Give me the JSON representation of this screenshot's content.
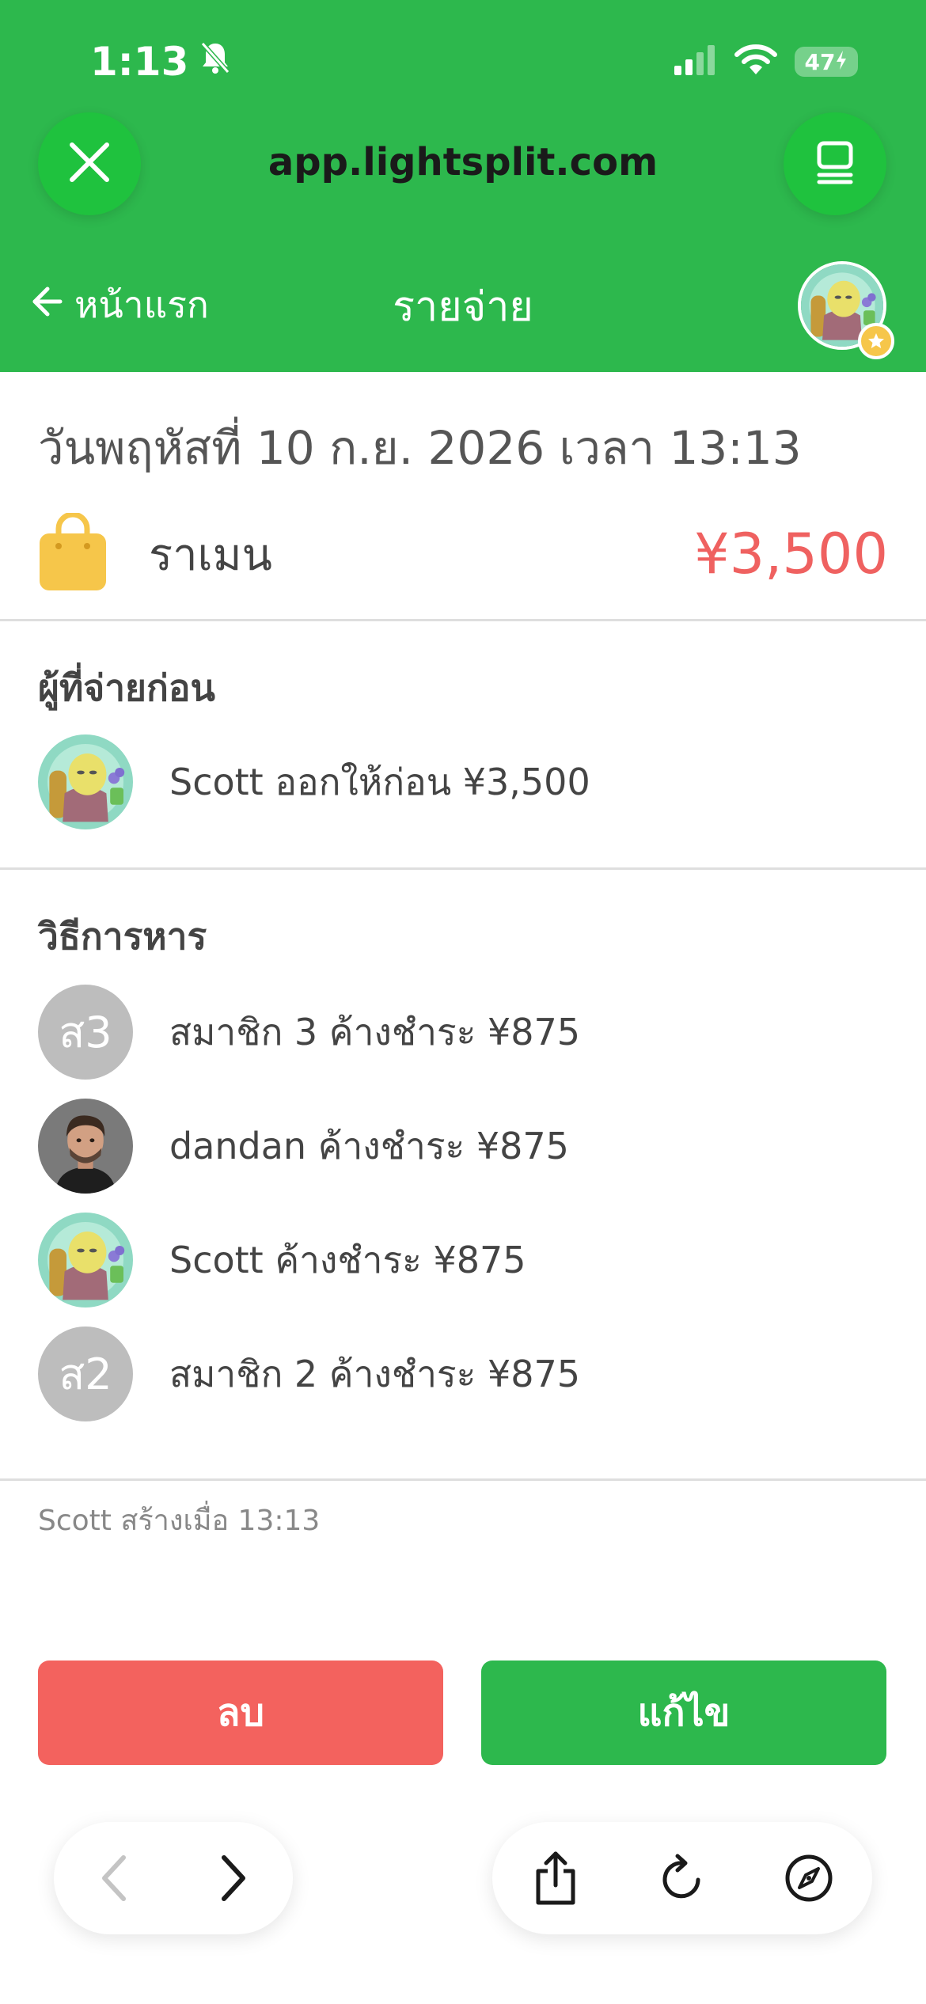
{
  "status_bar": {
    "time": "1:13",
    "battery": "47"
  },
  "browser": {
    "url": "app.lightsplit.com"
  },
  "nav": {
    "back_label": "หน้าแรก",
    "title": "รายจ่าย"
  },
  "expense": {
    "date": "วันพฤหัสที่ 10 ก.ย. 2026 เวลา 13:13",
    "name": "ราเมน",
    "amount": "¥3,500",
    "category_icon": "shopping-bag-icon"
  },
  "payers": {
    "title": "ผู้ที่จ่ายก่อน",
    "items": [
      {
        "avatar": "character-avatar",
        "text": "Scott ออกให้ก่อน ¥3,500"
      }
    ]
  },
  "split": {
    "title": "วิธีการหาร",
    "items": [
      {
        "avatar_text": "ส3",
        "text": "สมาชิก 3 ค้างชำระ ¥875"
      },
      {
        "avatar": "photo-avatar",
        "text": "dandan ค้างชำระ ¥875"
      },
      {
        "avatar": "character-avatar",
        "text": "Scott ค้างชำระ ¥875"
      },
      {
        "avatar_text": "ส2",
        "text": "สมาชิก 2 ค้างชำระ ¥875"
      }
    ]
  },
  "created_note": "Scott สร้างเมื่อ 13:13",
  "actions": {
    "delete_label": "ลบ",
    "edit_label": "แก้ไข"
  },
  "colors": {
    "brand_green": "#2db84d",
    "amount_red": "#ef6160",
    "delete_red": "#f3625e",
    "letter_avatar_gray": "#bdbdbd",
    "category_yellow": "#f6c64a"
  }
}
